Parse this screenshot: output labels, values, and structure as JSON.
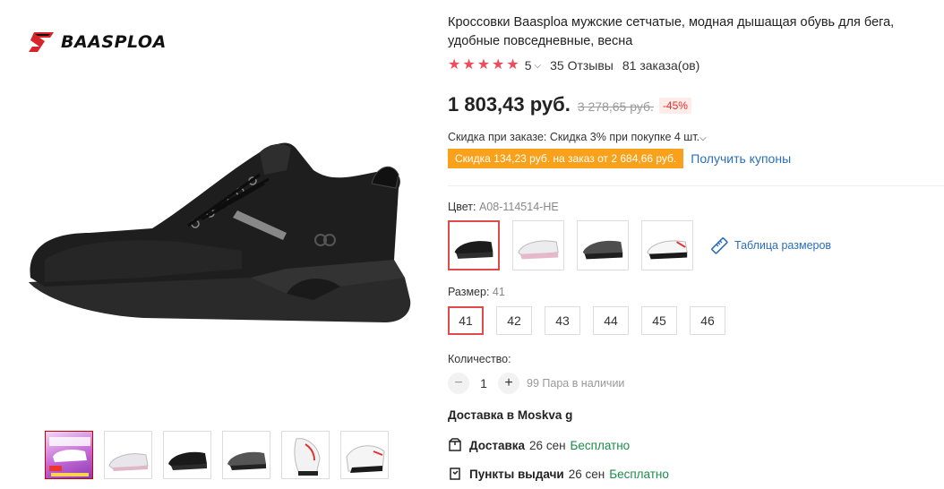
{
  "brand": {
    "logo_text": "BAASPLOA"
  },
  "gallery": {
    "thumbnails": [
      {
        "name": "thumb-promo",
        "color": "purple"
      },
      {
        "name": "thumb-white-pink",
        "color": "white"
      },
      {
        "name": "thumb-black",
        "color": "black"
      },
      {
        "name": "thumb-grey",
        "color": "grey"
      },
      {
        "name": "thumb-white-red-top",
        "color": "white"
      },
      {
        "name": "thumb-white-red-side",
        "color": "white"
      }
    ]
  },
  "product": {
    "title": "Кроссовки Baasploa мужские сетчатые, модная дышащая обувь для бега, удобные повседневные, весна",
    "rating": {
      "stars": 5,
      "value": "5",
      "reviews": "35 Отзывы",
      "orders": "81 заказа(ов)"
    },
    "price": {
      "current": "1 803,43 руб.",
      "old": "3 278,65 руб.",
      "discount": "-45%"
    },
    "order_discount": {
      "text": "Скидка при заказе: Скидка 3% при покупке 4 шт.",
      "badge": "Скидка 134,23 руб. на заказ от 2 684,66 руб.",
      "coupon_link": "Получить купоны"
    },
    "color": {
      "label": "Цвет:",
      "value": "A08-114514-HE",
      "size_chart": "Таблица размеров"
    },
    "size": {
      "label": "Размер:",
      "value": "41",
      "options": [
        "41",
        "42",
        "43",
        "44",
        "45",
        "46"
      ]
    },
    "quantity": {
      "label": "Количество:",
      "minus": "−",
      "value": "1",
      "plus": "+",
      "stock": "99 Пара в наличии"
    },
    "delivery": {
      "title": "Доставка в Moskva g",
      "rows": [
        {
          "label": "Доставка",
          "date": "26 сен",
          "price": "Бесплатно"
        },
        {
          "label": "Пункты выдачи",
          "date": "26 сен",
          "price": "Бесплатно"
        }
      ]
    }
  },
  "colors": {
    "accent": "#e24a4a",
    "star": "#f04a5d",
    "coupon": "#f9a11b",
    "link": "#2a6ebb",
    "free": "#1c8c4a"
  }
}
